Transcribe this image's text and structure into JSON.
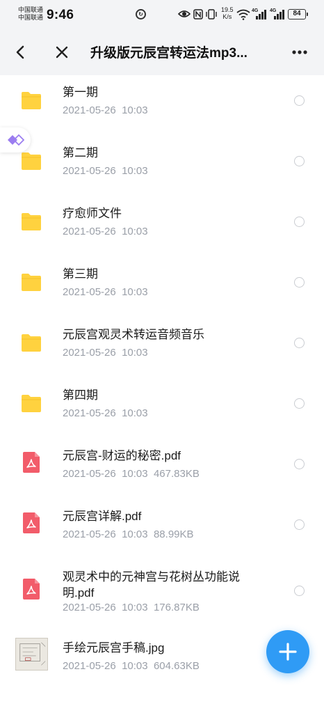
{
  "status_bar": {
    "carrier_1": "中国联通",
    "carrier_2": "中国联通",
    "time": "9:46",
    "net_speed_value": "19.5",
    "net_speed_unit": "K/s",
    "signal_1_label": "4G",
    "signal_2_label": "4G",
    "battery": "84"
  },
  "header": {
    "title": "升级版元辰宫转运法mp3..."
  },
  "files": [
    {
      "name": "第一期",
      "date": "2021-05-26",
      "time": "10:03",
      "size": "",
      "type": "folder"
    },
    {
      "name": "第二期",
      "date": "2021-05-26",
      "time": "10:03",
      "size": "",
      "type": "folder"
    },
    {
      "name": "疗愈师文件",
      "date": "2021-05-26",
      "time": "10:03",
      "size": "",
      "type": "folder"
    },
    {
      "name": "第三期",
      "date": "2021-05-26",
      "time": "10:03",
      "size": "",
      "type": "folder"
    },
    {
      "name": "元辰宫观灵术转运音频音乐",
      "date": "2021-05-26",
      "time": "10:03",
      "size": "",
      "type": "folder"
    },
    {
      "name": "第四期",
      "date": "2021-05-26",
      "time": "10:03",
      "size": "",
      "type": "folder"
    },
    {
      "name": "元辰宫-财运的秘密.pdf",
      "date": "2021-05-26",
      "time": "10:03",
      "size": "467.83KB",
      "type": "pdf"
    },
    {
      "name": "元辰宫详解.pdf",
      "date": "2021-05-26",
      "time": "10:03",
      "size": "88.99KB",
      "type": "pdf"
    },
    {
      "name": "观灵术中的元神宫与花树丛功能说明.pdf",
      "date": "2021-05-26",
      "time": "10:03",
      "size": "176.87KB",
      "type": "pdf"
    },
    {
      "name": "手绘元辰宫手稿.jpg",
      "date": "2021-05-26",
      "time": "10:03",
      "size": "604.63KB",
      "type": "image"
    }
  ],
  "colors": {
    "folder": "#FFD23F",
    "pdf": "#F25C6A",
    "fab": "#2F9BF5",
    "header_bg": "#F3F4F6",
    "meta_text": "#9A9FA8"
  },
  "icons": {
    "back": "chevron-left-icon",
    "close": "close-icon",
    "more": "more-dots-icon",
    "add": "plus-icon",
    "side_tab": "diamond-arrows-icon"
  }
}
